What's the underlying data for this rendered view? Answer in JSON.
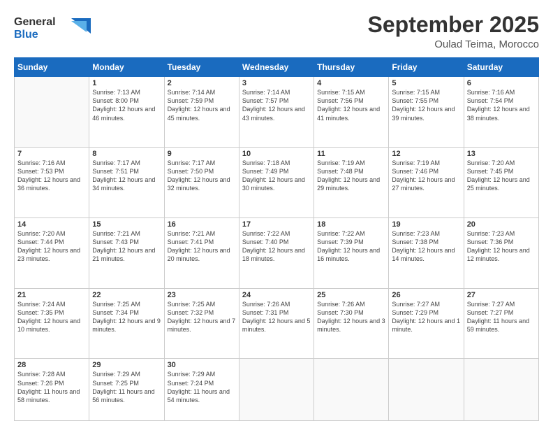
{
  "header": {
    "logo_line1": "General",
    "logo_line2": "Blue",
    "month": "September 2025",
    "location": "Oulad Teima, Morocco"
  },
  "weekdays": [
    "Sunday",
    "Monday",
    "Tuesday",
    "Wednesday",
    "Thursday",
    "Friday",
    "Saturday"
  ],
  "weeks": [
    [
      {
        "day": "",
        "info": ""
      },
      {
        "day": "1",
        "info": "Sunrise: 7:13 AM\nSunset: 8:00 PM\nDaylight: 12 hours\nand 46 minutes."
      },
      {
        "day": "2",
        "info": "Sunrise: 7:14 AM\nSunset: 7:59 PM\nDaylight: 12 hours\nand 45 minutes."
      },
      {
        "day": "3",
        "info": "Sunrise: 7:14 AM\nSunset: 7:57 PM\nDaylight: 12 hours\nand 43 minutes."
      },
      {
        "day": "4",
        "info": "Sunrise: 7:15 AM\nSunset: 7:56 PM\nDaylight: 12 hours\nand 41 minutes."
      },
      {
        "day": "5",
        "info": "Sunrise: 7:15 AM\nSunset: 7:55 PM\nDaylight: 12 hours\nand 39 minutes."
      },
      {
        "day": "6",
        "info": "Sunrise: 7:16 AM\nSunset: 7:54 PM\nDaylight: 12 hours\nand 38 minutes."
      }
    ],
    [
      {
        "day": "7",
        "info": "Sunrise: 7:16 AM\nSunset: 7:53 PM\nDaylight: 12 hours\nand 36 minutes."
      },
      {
        "day": "8",
        "info": "Sunrise: 7:17 AM\nSunset: 7:51 PM\nDaylight: 12 hours\nand 34 minutes."
      },
      {
        "day": "9",
        "info": "Sunrise: 7:17 AM\nSunset: 7:50 PM\nDaylight: 12 hours\nand 32 minutes."
      },
      {
        "day": "10",
        "info": "Sunrise: 7:18 AM\nSunset: 7:49 PM\nDaylight: 12 hours\nand 30 minutes."
      },
      {
        "day": "11",
        "info": "Sunrise: 7:19 AM\nSunset: 7:48 PM\nDaylight: 12 hours\nand 29 minutes."
      },
      {
        "day": "12",
        "info": "Sunrise: 7:19 AM\nSunset: 7:46 PM\nDaylight: 12 hours\nand 27 minutes."
      },
      {
        "day": "13",
        "info": "Sunrise: 7:20 AM\nSunset: 7:45 PM\nDaylight: 12 hours\nand 25 minutes."
      }
    ],
    [
      {
        "day": "14",
        "info": "Sunrise: 7:20 AM\nSunset: 7:44 PM\nDaylight: 12 hours\nand 23 minutes."
      },
      {
        "day": "15",
        "info": "Sunrise: 7:21 AM\nSunset: 7:43 PM\nDaylight: 12 hours\nand 21 minutes."
      },
      {
        "day": "16",
        "info": "Sunrise: 7:21 AM\nSunset: 7:41 PM\nDaylight: 12 hours\nand 20 minutes."
      },
      {
        "day": "17",
        "info": "Sunrise: 7:22 AM\nSunset: 7:40 PM\nDaylight: 12 hours\nand 18 minutes."
      },
      {
        "day": "18",
        "info": "Sunrise: 7:22 AM\nSunset: 7:39 PM\nDaylight: 12 hours\nand 16 minutes."
      },
      {
        "day": "19",
        "info": "Sunrise: 7:23 AM\nSunset: 7:38 PM\nDaylight: 12 hours\nand 14 minutes."
      },
      {
        "day": "20",
        "info": "Sunrise: 7:23 AM\nSunset: 7:36 PM\nDaylight: 12 hours\nand 12 minutes."
      }
    ],
    [
      {
        "day": "21",
        "info": "Sunrise: 7:24 AM\nSunset: 7:35 PM\nDaylight: 12 hours\nand 10 minutes."
      },
      {
        "day": "22",
        "info": "Sunrise: 7:25 AM\nSunset: 7:34 PM\nDaylight: 12 hours\nand 9 minutes."
      },
      {
        "day": "23",
        "info": "Sunrise: 7:25 AM\nSunset: 7:32 PM\nDaylight: 12 hours\nand 7 minutes."
      },
      {
        "day": "24",
        "info": "Sunrise: 7:26 AM\nSunset: 7:31 PM\nDaylight: 12 hours\nand 5 minutes."
      },
      {
        "day": "25",
        "info": "Sunrise: 7:26 AM\nSunset: 7:30 PM\nDaylight: 12 hours\nand 3 minutes."
      },
      {
        "day": "26",
        "info": "Sunrise: 7:27 AM\nSunset: 7:29 PM\nDaylight: 12 hours\nand 1 minute."
      },
      {
        "day": "27",
        "info": "Sunrise: 7:27 AM\nSunset: 7:27 PM\nDaylight: 11 hours\nand 59 minutes."
      }
    ],
    [
      {
        "day": "28",
        "info": "Sunrise: 7:28 AM\nSunset: 7:26 PM\nDaylight: 11 hours\nand 58 minutes."
      },
      {
        "day": "29",
        "info": "Sunrise: 7:29 AM\nSunset: 7:25 PM\nDaylight: 11 hours\nand 56 minutes."
      },
      {
        "day": "30",
        "info": "Sunrise: 7:29 AM\nSunset: 7:24 PM\nDaylight: 11 hours\nand 54 minutes."
      },
      {
        "day": "",
        "info": ""
      },
      {
        "day": "",
        "info": ""
      },
      {
        "day": "",
        "info": ""
      },
      {
        "day": "",
        "info": ""
      }
    ]
  ]
}
